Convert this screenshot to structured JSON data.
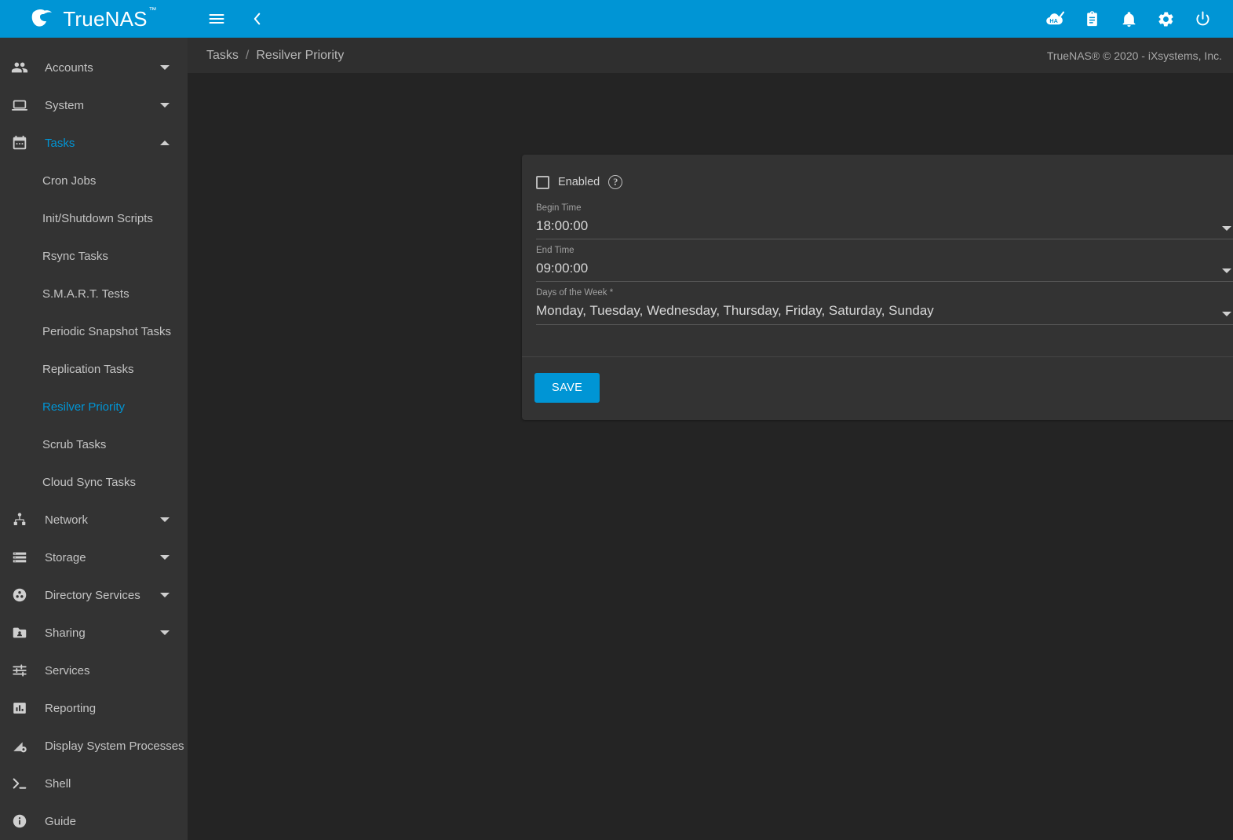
{
  "brand": {
    "name": "TrueNAS",
    "trademark": "™",
    "logo_icon": "truenas-wave-logo"
  },
  "topbar": {
    "menu_icon": "hamburger-menu-icon",
    "collapse_icon": "chevron-left-icon",
    "actions": [
      {
        "icon": "ha-cloud-status-icon",
        "label": "HA"
      },
      {
        "icon": "clipboard-tasks-icon",
        "label": "Jobs"
      },
      {
        "icon": "bell-notifications-icon",
        "label": "Alerts"
      },
      {
        "icon": "gear-settings-icon",
        "label": "Settings"
      },
      {
        "icon": "power-icon",
        "label": "Power"
      }
    ]
  },
  "breadcrumb": {
    "items": [
      "Tasks",
      "Resilver Priority"
    ],
    "separator": "/",
    "copyright": "TrueNAS® © 2020 - iXsystems, Inc."
  },
  "sidebar": {
    "items": [
      {
        "label": "Accounts",
        "icon": "people-icon",
        "type": "group",
        "expanded": false,
        "active": false
      },
      {
        "label": "System",
        "icon": "laptop-icon",
        "type": "group",
        "expanded": false,
        "active": false
      },
      {
        "label": "Tasks",
        "icon": "calendar-icon",
        "type": "group",
        "expanded": true,
        "active": true
      },
      {
        "label": "Cron Jobs",
        "type": "sub",
        "active": false
      },
      {
        "label": "Init/Shutdown Scripts",
        "type": "sub",
        "active": false
      },
      {
        "label": "Rsync Tasks",
        "type": "sub",
        "active": false
      },
      {
        "label": "S.M.A.R.T. Tests",
        "type": "sub",
        "active": false
      },
      {
        "label": "Periodic Snapshot Tasks",
        "type": "sub",
        "active": false
      },
      {
        "label": "Replication Tasks",
        "type": "sub",
        "active": false
      },
      {
        "label": "Resilver Priority",
        "type": "sub",
        "active": true
      },
      {
        "label": "Scrub Tasks",
        "type": "sub",
        "active": false
      },
      {
        "label": "Cloud Sync Tasks",
        "type": "sub",
        "active": false
      },
      {
        "label": "Network",
        "icon": "network-nodes-icon",
        "type": "group",
        "expanded": false,
        "active": false
      },
      {
        "label": "Storage",
        "icon": "storage-stack-icon",
        "type": "group",
        "expanded": false,
        "active": false
      },
      {
        "label": "Directory Services",
        "icon": "directory-disc-icon",
        "type": "group",
        "expanded": false,
        "active": false
      },
      {
        "label": "Sharing",
        "icon": "shared-folder-icon",
        "type": "group",
        "expanded": false,
        "active": false
      },
      {
        "label": "Services",
        "icon": "sliders-icon",
        "type": "link",
        "active": false
      },
      {
        "label": "Reporting",
        "icon": "bar-chart-icon",
        "type": "link",
        "active": false
      },
      {
        "label": "Display System Processes",
        "icon": "processes-gear-icon",
        "type": "link",
        "active": false
      },
      {
        "label": "Shell",
        "icon": "terminal-prompt-icon",
        "type": "link",
        "active": false
      },
      {
        "label": "Guide",
        "icon": "info-circle-icon",
        "type": "link",
        "active": false
      }
    ]
  },
  "form": {
    "enabled": {
      "label": "Enabled",
      "checked": false,
      "help_icon": "question-mark-icon",
      "help_glyph": "?"
    },
    "fields": [
      {
        "label": "Begin Time",
        "value": "18:00:00",
        "caret_icon": "chevron-down-icon",
        "help_icon": "question-mark-icon",
        "help_glyph": "?"
      },
      {
        "label": "End Time",
        "value": "09:00:00",
        "caret_icon": "chevron-down-icon",
        "help_icon": "question-mark-icon",
        "help_glyph": "?"
      },
      {
        "label": "Days of the Week *",
        "value": "Monday, Tuesday, Wednesday, Thursday, Friday, Saturday, Sunday",
        "caret_icon": "chevron-down-icon",
        "help_icon": "question-mark-icon",
        "help_glyph": "?"
      }
    ],
    "save_label": "SAVE"
  },
  "colors": {
    "accent": "#0095d5",
    "sidebar_bg": "#333333",
    "content_bg": "#242424",
    "card_bg": "#333333",
    "breadcrumb_bg": "#2f2f2f",
    "text_primary": "#d8d8d8",
    "text_muted": "#a0a0a0"
  }
}
